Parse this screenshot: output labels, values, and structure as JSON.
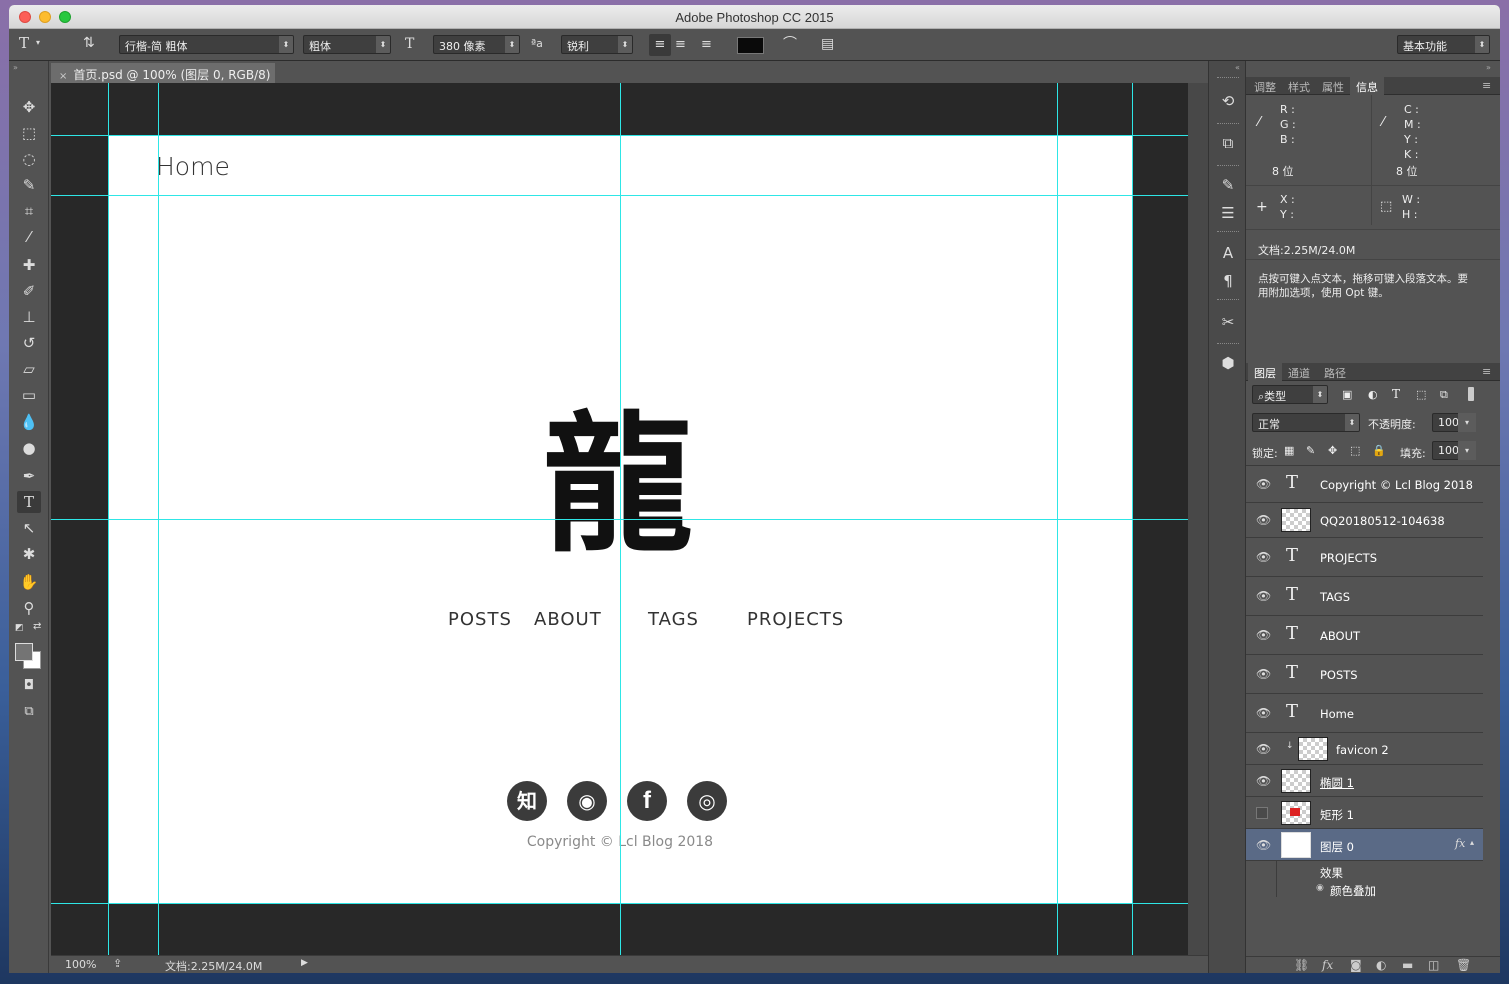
{
  "window": {
    "title": "Adobe Photoshop CC 2015"
  },
  "options_bar": {
    "tool_icon": "T",
    "font_family": "行楷-简 粗体",
    "font_style": "粗体",
    "font_size": "380 像素",
    "aa_label": "ªa",
    "antialias": "锐利",
    "workspace": "基本功能"
  },
  "document_tab": {
    "label": "首页.psd @ 100% (图层 0, RGB/8)"
  },
  "canvas": {
    "heading": "Home",
    "logo_char": "龍",
    "nav": [
      "POSTS",
      "ABOUT",
      "TAGS",
      "PROJECTS"
    ],
    "social_icons": [
      {
        "name": "zhihu-icon",
        "glyph": "知"
      },
      {
        "name": "weibo-icon",
        "glyph": "◉"
      },
      {
        "name": "facebook-icon",
        "glyph": "f"
      },
      {
        "name": "github-icon",
        "glyph": "◎"
      }
    ],
    "copyright": "Copyright © Lcl Blog 2018"
  },
  "status_bar": {
    "zoom": "100%",
    "doc_info": "文档:2.25M/24.0M"
  },
  "info_panel": {
    "tabs": [
      "调整",
      "样式",
      "属性",
      "信息"
    ],
    "active_tab": "信息",
    "rgb_labels": [
      "R :",
      "G :",
      "B :"
    ],
    "cmyk_labels": [
      "C :",
      "M :",
      "Y :",
      "K :"
    ],
    "bits_left": "8 位",
    "bits_right": "8 位",
    "xy_labels": [
      "X :",
      "Y :"
    ],
    "wh_labels": [
      "W :",
      "H :"
    ],
    "doc_size": "文档:2.25M/24.0M",
    "hint_line1": "点按可键入点文本，拖移可键入段落文本。要",
    "hint_line2": "用附加选项，使用 Opt 键。"
  },
  "layers_panel": {
    "tabs": [
      "图层",
      "通道",
      "路径"
    ],
    "filter_kind": "类型",
    "blend_mode": "正常",
    "opacity_label": "不透明度:",
    "opacity_value": "100%",
    "lock_label": "锁定:",
    "fill_label": "填充:",
    "fill_value": "100%",
    "layers": [
      {
        "name": "Copyright © Lcl Blog 2018",
        "kind": "text",
        "visible": true
      },
      {
        "name": "QQ20180512-104638",
        "kind": "smart",
        "visible": true
      },
      {
        "name": "PROJECTS",
        "kind": "text",
        "visible": true
      },
      {
        "name": "TAGS",
        "kind": "text",
        "visible": true
      },
      {
        "name": "ABOUT",
        "kind": "text",
        "visible": true
      },
      {
        "name": "POSTS",
        "kind": "text",
        "visible": true
      },
      {
        "name": "Home",
        "kind": "text",
        "visible": true
      },
      {
        "name": "favicon 2",
        "kind": "smart",
        "visible": true
      },
      {
        "name": "椭圆 1",
        "kind": "shape",
        "visible": true
      },
      {
        "name": "矩形 1",
        "kind": "shape",
        "visible": false
      },
      {
        "name": "图层 0",
        "kind": "pixel",
        "visible": true,
        "selected": true
      }
    ],
    "effects_label": "效果",
    "effect_item": "颜色叠加"
  },
  "colors": {
    "guide": "#2ee6e6",
    "panel_bg": "#535353",
    "pasteboard": "#282828",
    "selection": "#5a6a86"
  }
}
